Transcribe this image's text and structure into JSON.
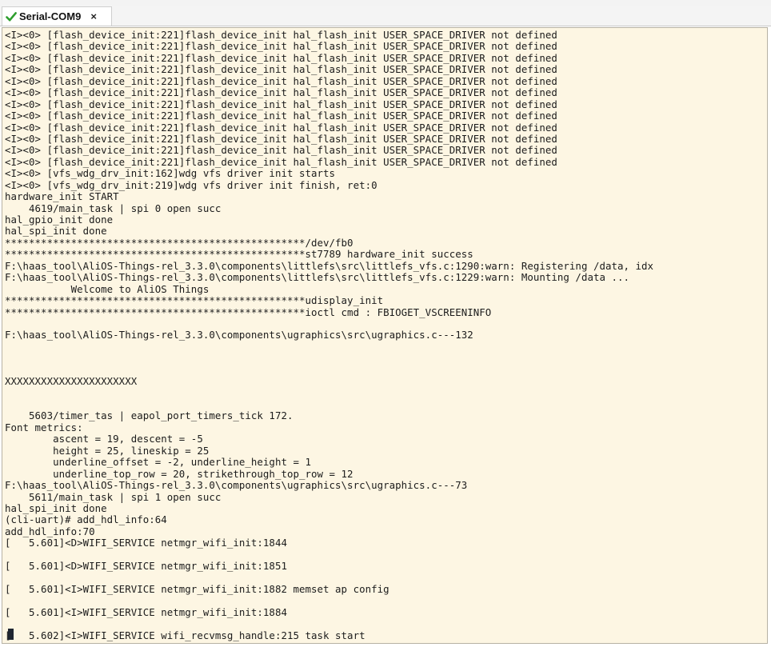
{
  "window": {
    "top_text": "                                                                                                   ",
    "tab": {
      "label": "Serial-COM9",
      "close_glyph": "×",
      "status_icon": "green-check-icon",
      "status_color": "#2e9e2e"
    }
  },
  "terminal": {
    "background": "#fdf6e3",
    "lines": [
      "<I><0> [flash_device_init:221]flash_device_init hal_flash_init USER_SPACE_DRIVER not defined",
      "<I><0> [flash_device_init:221]flash_device_init hal_flash_init USER_SPACE_DRIVER not defined",
      "<I><0> [flash_device_init:221]flash_device_init hal_flash_init USER_SPACE_DRIVER not defined",
      "<I><0> [flash_device_init:221]flash_device_init hal_flash_init USER_SPACE_DRIVER not defined",
      "<I><0> [flash_device_init:221]flash_device_init hal_flash_init USER_SPACE_DRIVER not defined",
      "<I><0> [flash_device_init:221]flash_device_init hal_flash_init USER_SPACE_DRIVER not defined",
      "<I><0> [flash_device_init:221]flash_device_init hal_flash_init USER_SPACE_DRIVER not defined",
      "<I><0> [flash_device_init:221]flash_device_init hal_flash_init USER_SPACE_DRIVER not defined",
      "<I><0> [flash_device_init:221]flash_device_init hal_flash_init USER_SPACE_DRIVER not defined",
      "<I><0> [flash_device_init:221]flash_device_init hal_flash_init USER_SPACE_DRIVER not defined",
      "<I><0> [flash_device_init:221]flash_device_init hal_flash_init USER_SPACE_DRIVER not defined",
      "<I><0> [flash_device_init:221]flash_device_init hal_flash_init USER_SPACE_DRIVER not defined",
      "<I><0> [vfs_wdg_drv_init:162]wdg vfs driver init starts",
      "<I><0> [vfs_wdg_drv_init:219]wdg vfs driver init finish, ret:0",
      "hardware_init START",
      "    4619/main_task | spi 0 open succ",
      "hal_gpio_init done",
      "hal_spi_init done",
      "**************************************************/dev/fb0",
      "**************************************************st7789 hardware_init success",
      "F:\\haas_tool\\AliOS-Things-rel_3.3.0\\components\\littlefs\\src\\littlefs_vfs.c:1290:warn: Registering /data, idx",
      "F:\\haas_tool\\AliOS-Things-rel_3.3.0\\components\\littlefs\\src\\littlefs_vfs.c:1229:warn: Mounting /data ...",
      "           Welcome to AliOS Things",
      "**************************************************udisplay_init",
      "**************************************************ioctl cmd : FBIOGET_VSCREENINFO",
      "",
      "F:\\haas_tool\\AliOS-Things-rel_3.3.0\\components\\ugraphics\\src\\ugraphics.c---132",
      "",
      "",
      "",
      "XXXXXXXXXXXXXXXXXXXXXX",
      "",
      "",
      "    5603/timer_tas | eapol_port_timers_tick 172.",
      "Font metrics:",
      "        ascent = 19, descent = -5",
      "        height = 25, lineskip = 25",
      "        underline_offset = -2, underline_height = 1",
      "        underline_top_row = 20, strikethrough_top_row = 12",
      "F:\\haas_tool\\AliOS-Things-rel_3.3.0\\components\\ugraphics\\src\\ugraphics.c---73",
      "    5611/main_task | spi 1 open succ",
      "hal_spi_init done",
      "(cli-uart)# add_hdl_info:64",
      "add_hdl_info:70",
      "[   5.601]<D>WIFI_SERVICE netmgr_wifi_init:1844",
      "",
      "[   5.601]<D>WIFI_SERVICE netmgr_wifi_init:1851",
      "",
      "[   5.601]<I>WIFI_SERVICE netmgr_wifi_init:1882 memset ap config",
      "",
      "[   5.601]<I>WIFI_SERVICE netmgr_wifi_init:1884",
      "",
      "[   5.602]<I>WIFI_SERVICE wifi_recvmsg_handle:215 task start"
    ]
  }
}
